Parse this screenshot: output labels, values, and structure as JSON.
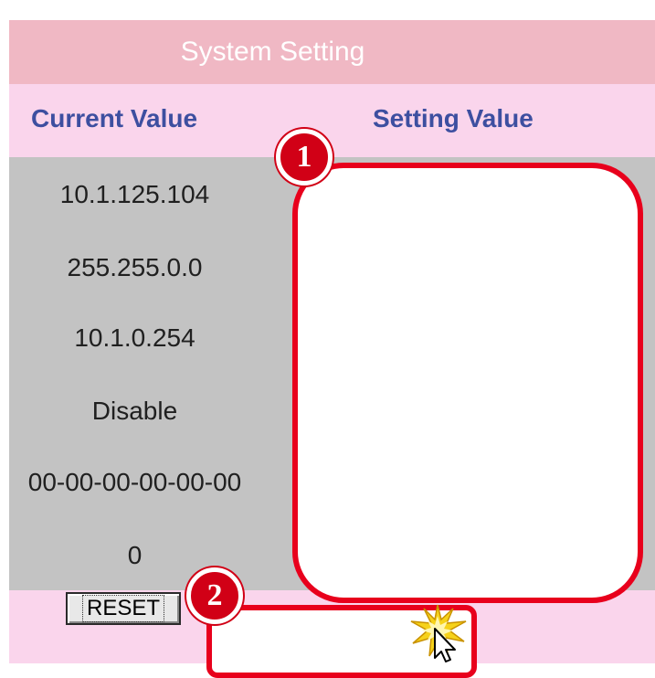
{
  "title": "System Setting",
  "columns": {
    "current": "Current Value",
    "setting": "Setting Value"
  },
  "current_values": [
    "10.1.125.104",
    "255.255.0.0",
    "10.1.0.254",
    "Disable",
    "00-00-00-00-00-00",
    "0"
  ],
  "buttons": {
    "reset": "RESET"
  },
  "callouts": [
    "1",
    "2"
  ],
  "colors": {
    "title_bg": "#f0b8c4",
    "header_bg": "#fad5ec",
    "data_bg": "#c3c3c3",
    "highlight": "#e8001c",
    "column_text": "#3d4fa0"
  },
  "icons": {
    "cursor": "click-cursor-icon"
  }
}
